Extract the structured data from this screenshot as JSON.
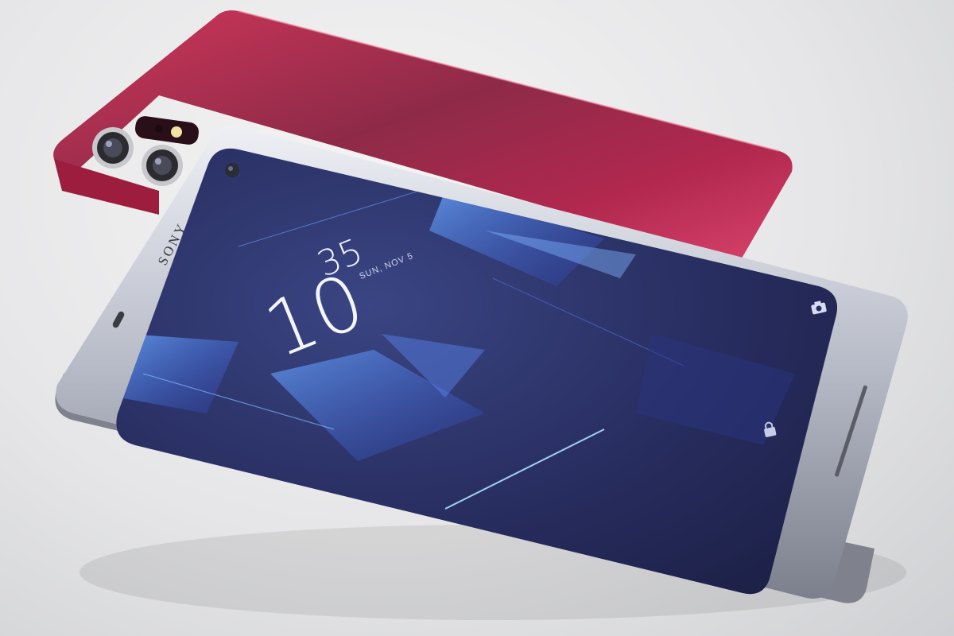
{
  "scene": {
    "brand": "SONY",
    "lockscreen": {
      "hour": "10",
      "minute": "35",
      "date": "SUN, NOV 5"
    },
    "icons": [
      "camera-icon",
      "lock-icon"
    ]
  },
  "colors": {
    "back_phone": "#c8234f",
    "screen": "#2a2f63",
    "frame": "#c9ccd6"
  }
}
